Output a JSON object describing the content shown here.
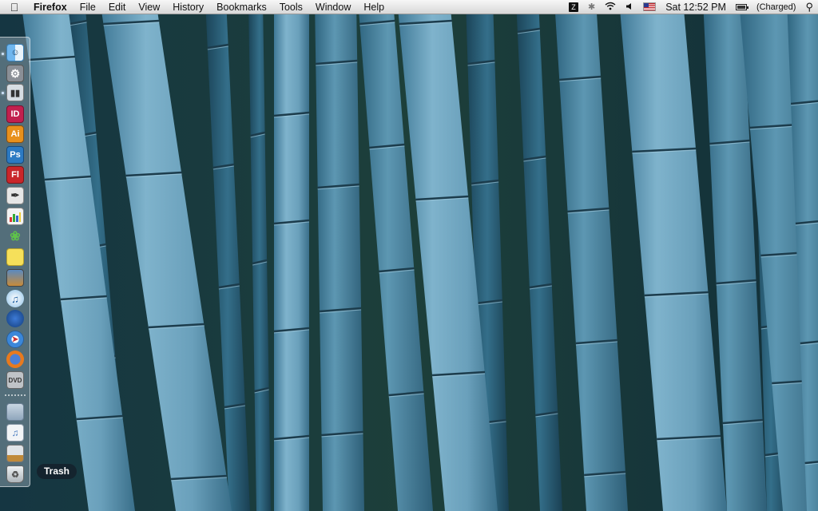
{
  "menubar": {
    "app_name": "Firefox",
    "menus": [
      "File",
      "Edit",
      "View",
      "History",
      "Bookmarks",
      "Tools",
      "Window",
      "Help"
    ],
    "status": {
      "clock": "Sat 12:52 PM",
      "battery": "(Charged)",
      "time_machine_label": "Z"
    }
  },
  "dock": {
    "items": [
      {
        "name": "finder-icon",
        "label": ""
      },
      {
        "name": "system-preferences-icon",
        "label": ""
      },
      {
        "name": "preview-icon",
        "label": ""
      },
      {
        "name": "indesign-icon",
        "label": "ID"
      },
      {
        "name": "illustrator-icon",
        "label": "Ai"
      },
      {
        "name": "photoshop-icon",
        "label": "Ps"
      },
      {
        "name": "flash-icon",
        "label": "Fl"
      },
      {
        "name": "pen-tool-icon",
        "label": ""
      },
      {
        "name": "charts-icon",
        "label": ""
      },
      {
        "name": "cyberduck-icon",
        "label": ""
      },
      {
        "name": "stickies-icon",
        "label": ""
      },
      {
        "name": "iphoto-icon",
        "label": ""
      },
      {
        "name": "itunes-icon",
        "label": ""
      },
      {
        "name": "ical-icon",
        "label": ""
      },
      {
        "name": "safari-icon",
        "label": ""
      },
      {
        "name": "firefox-icon",
        "label": ""
      },
      {
        "name": "dvd-player-icon",
        "label": ""
      },
      {
        "name": "applications-folder-icon",
        "label": ""
      },
      {
        "name": "documents-stack-icon",
        "label": ""
      },
      {
        "name": "downloads-stack-icon",
        "label": ""
      },
      {
        "name": "trash-icon",
        "label": ""
      }
    ],
    "tooltip": "Trash"
  },
  "colors": {
    "bamboo_light": "#6ea3bf",
    "bamboo_dark": "#2c5e78",
    "background_dark": "#0f2a33"
  }
}
